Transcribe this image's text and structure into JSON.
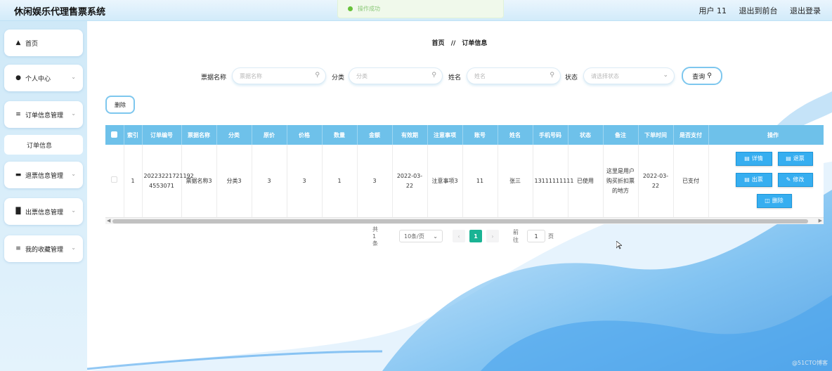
{
  "header": {
    "app_title": "休闲娱乐代理售票系统",
    "user_label": "用户 11",
    "back_to_front": "退出到前台",
    "logout": "退出登录"
  },
  "toast": {
    "message": "操作成功"
  },
  "sidebar": {
    "items": [
      {
        "label": "首页",
        "icon": "home-icon"
      },
      {
        "label": "个人中心",
        "icon": "user-icon"
      },
      {
        "label": "订单信息管理",
        "icon": "list-icon"
      },
      {
        "label": "订单信息",
        "icon": ""
      },
      {
        "label": "退票信息管理",
        "icon": "ticket-icon"
      },
      {
        "label": "出票信息管理",
        "icon": "chart-icon"
      },
      {
        "label": "我的收藏管理",
        "icon": "list-icon"
      }
    ]
  },
  "breadcrumb": {
    "home": "首页",
    "separator": "//",
    "current": "订单信息"
  },
  "search": {
    "ticket_name_label": "票据名称",
    "ticket_name_placeholder": "票据名称",
    "category_label": "分类",
    "category_placeholder": "分类",
    "name_label": "姓名",
    "name_placeholder": "姓名",
    "status_label": "状态",
    "status_placeholder": "请选择状态",
    "query_button": "查询"
  },
  "toolbar": {
    "delete_button": "删除"
  },
  "table": {
    "columns": [
      "索引",
      "订单编号",
      "票据名称",
      "分类",
      "原价",
      "价格",
      "数量",
      "金额",
      "有效期",
      "注意事项",
      "账号",
      "姓名",
      "手机号码",
      "状态",
      "备注",
      "下单时间",
      "是否支付",
      "操作"
    ],
    "rows": [
      {
        "index": "1",
        "order_no": "20223221721192 4553071",
        "ticket_name": "票据名称3",
        "category": "分类3",
        "original_price": "3",
        "price": "3",
        "quantity": "1",
        "amount": "3",
        "valid_until": "2022-03-22",
        "notes": "注意事项3",
        "account": "11",
        "name": "张三",
        "phone": "13111111111",
        "status": "已使用",
        "remark": "这里是用户购买折扣票的地方",
        "order_time": "2022-03-22",
        "paid": "已支付"
      }
    ],
    "row_actions": {
      "detail": "详情",
      "refund": "退票",
      "issue": "出票",
      "edit": "修改",
      "delete": "删除"
    }
  },
  "pagination": {
    "total": "共 1 条",
    "page_size": "10条/页",
    "current_page": "1",
    "goto_label": "前往",
    "goto_value": "1",
    "page_suffix": "页"
  },
  "watermark": "@51CTO博客",
  "colors": {
    "accent": "#36aef0",
    "header_bg": "#6ec1ea",
    "pager_active": "#1ab394"
  }
}
